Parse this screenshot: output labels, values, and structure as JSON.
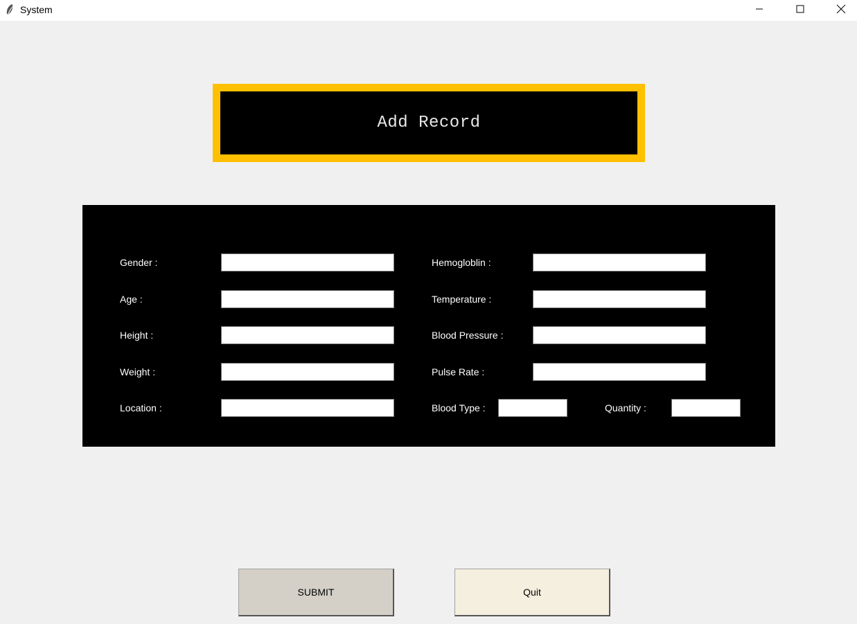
{
  "window": {
    "title": "System",
    "icons": {
      "app": "feather-icon",
      "minimize": "minimize-icon",
      "maximize": "maximize-icon",
      "close": "close-icon"
    }
  },
  "header": {
    "title": "Add Record",
    "border_color": "#ffc000",
    "background": "#000000"
  },
  "form": {
    "left": {
      "gender_label": "Gender :",
      "gender_value": "",
      "age_label": "Age :",
      "age_value": "",
      "height_label": "Height :",
      "height_value": "",
      "weight_label": "Weight :",
      "weight_value": "",
      "location_label": "Location :",
      "location_value": ""
    },
    "right": {
      "hemoglobin_label": "Hemogloblin :",
      "hemoglobin_value": "",
      "temperature_label": "Temperature :",
      "temperature_value": "",
      "blood_pressure_label": "Blood Pressure :",
      "blood_pressure_value": "",
      "pulse_rate_label": "Pulse Rate :",
      "pulse_rate_value": "",
      "blood_type_label": "Blood Type :",
      "blood_type_value": "",
      "quantity_label": "Quantity :",
      "quantity_value": ""
    }
  },
  "buttons": {
    "submit_label": "SUBMIT",
    "quit_label": "Quit",
    "submit_color": "#d4d0c8",
    "quit_color": "#f5efe0"
  }
}
